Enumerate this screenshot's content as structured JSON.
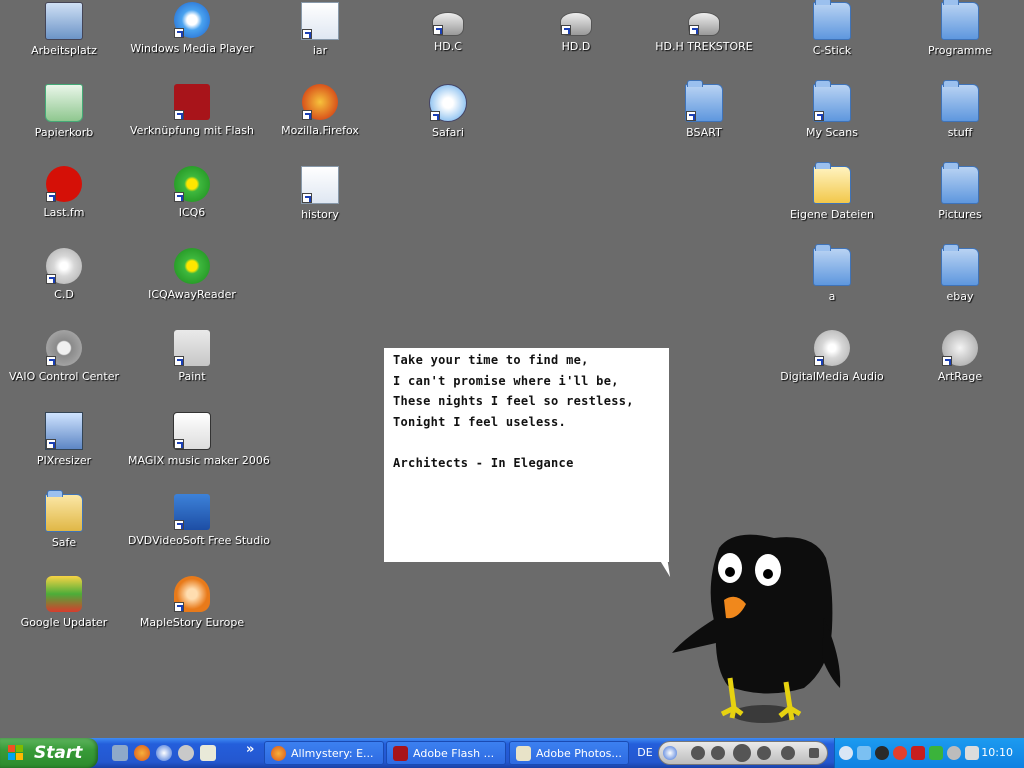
{
  "desktop": {
    "icons": [
      {
        "label": "Arbeitsplatz",
        "type": "computer",
        "shortcut": false
      },
      {
        "label": "Windows Media Player",
        "type": "media",
        "shortcut": true
      },
      {
        "label": "iar",
        "type": "file",
        "shortcut": true
      },
      {
        "label": "HD.C",
        "type": "drive",
        "shortcut": true
      },
      {
        "label": "HD.D",
        "type": "drive",
        "shortcut": true
      },
      {
        "label": "HD.H TREKSTORE",
        "type": "drive",
        "shortcut": true
      },
      {
        "label": "C-Stick",
        "type": "folder",
        "shortcut": false
      },
      {
        "label": "Programme",
        "type": "folder",
        "shortcut": false
      },
      {
        "label": "Papierkorb",
        "type": "recycle",
        "shortcut": false
      },
      {
        "label": "Verknüpfung mit Flash",
        "type": "flash",
        "shortcut": true
      },
      {
        "label": "Mozilla.Firefox",
        "type": "firefox",
        "shortcut": true
      },
      {
        "label": "Safari",
        "type": "safari",
        "shortcut": true
      },
      {
        "label": "BSART",
        "type": "folder",
        "shortcut": true
      },
      {
        "label": "My Scans",
        "type": "folder",
        "shortcut": true
      },
      {
        "label": "stuff",
        "type": "folder",
        "shortcut": false
      },
      {
        "label": "Last.fm",
        "type": "lastfm",
        "shortcut": true
      },
      {
        "label": "ICQ6",
        "type": "icq",
        "shortcut": true
      },
      {
        "label": "history",
        "type": "file",
        "shortcut": true
      },
      {
        "label": "Eigene Dateien",
        "type": "folder-open",
        "shortcut": false
      },
      {
        "label": "Pictures",
        "type": "folder",
        "shortcut": false
      },
      {
        "label": "C.D",
        "type": "cd",
        "shortcut": true
      },
      {
        "label": "ICQAwayReader",
        "type": "icq",
        "shortcut": false
      },
      {
        "label": "a",
        "type": "folder",
        "shortcut": false
      },
      {
        "label": "ebay",
        "type": "folder",
        "shortcut": false
      },
      {
        "label": "VAIO Control Center",
        "type": "gear",
        "shortcut": true
      },
      {
        "label": "Paint",
        "type": "paint",
        "shortcut": true
      },
      {
        "label": "DigitalMedia Audio",
        "type": "cd",
        "shortcut": true
      },
      {
        "label": "ArtRage",
        "type": "artrage",
        "shortcut": true
      },
      {
        "label": "PIXresizer",
        "type": "pix",
        "shortcut": true
      },
      {
        "label": "MAGIX music maker 2006",
        "type": "speaker",
        "shortcut": true
      },
      {
        "label": "Safe",
        "type": "folder-safe",
        "shortcut": false
      },
      {
        "label": "DVDVideoSoft Free Studio",
        "type": "fs",
        "shortcut": true
      },
      {
        "label": "Google Updater",
        "type": "updater",
        "shortcut": false
      },
      {
        "label": "MapleStory Europe",
        "type": "mushroom",
        "shortcut": true
      }
    ]
  },
  "wallpaper_note": {
    "lines": [
      "Take your time to find me,",
      "I can't promise where i'll be,",
      "These nights I feel so restless,",
      "Tonight I feel useless."
    ],
    "credit": "Architects - In Elegance"
  },
  "taskbar": {
    "start_label": "Start",
    "quick_launch_more": "»",
    "buttons": [
      {
        "label": "Allmystery: E...",
        "icon": "firefox-icon"
      },
      {
        "label": "Adobe Flash ...",
        "icon": "flash-icon"
      },
      {
        "label": "Adobe Photos...",
        "icon": "photoshop-icon"
      }
    ],
    "language": "DE",
    "clock": "10:10"
  },
  "colors": {
    "desktop": "#6b6b6b",
    "taskbar": "#245edb",
    "start": "#389b38",
    "tray": "#0f81e2"
  }
}
